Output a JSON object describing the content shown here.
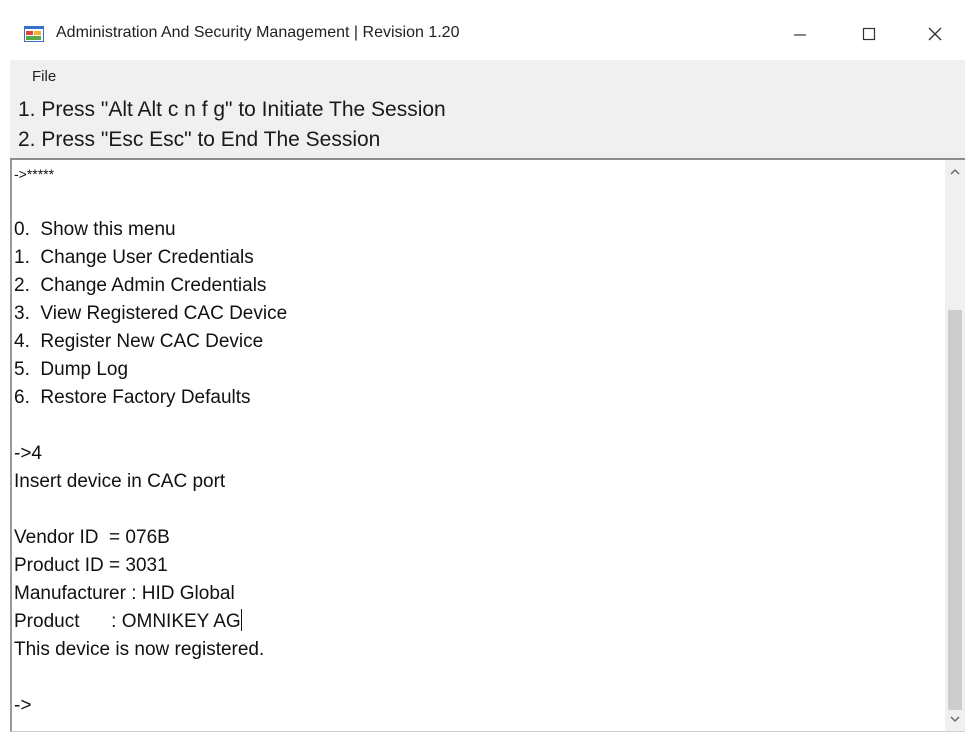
{
  "window": {
    "title": "Administration And Security Management  |  Revision 1.20",
    "icon": "app-window-icon",
    "controls": {
      "minimize_icon": "minimize-icon",
      "maximize_icon": "maximize-icon",
      "close_icon": "close-icon"
    }
  },
  "menubar": {
    "items": [
      {
        "label": "File"
      }
    ]
  },
  "instructions": [
    "1. Press \"Alt Alt c n f g\" to Initiate The Session",
    "2. Press \"Esc Esc\" to End The Session"
  ],
  "console": {
    "lines": [
      "->*****",
      "",
      "0.  Show this menu",
      "1.  Change User Credentials",
      "2.  Change Admin Credentials",
      "3.  View Registered CAC Device",
      "4.  Register New CAC Device",
      "5.  Dump Log",
      "6.  Restore Factory Defaults",
      "",
      "->4",
      "Insert device in CAC port",
      "",
      "Vendor ID  = 076B",
      "Product ID = 3031",
      "Manufacturer : HID Global",
      "Product      : OMNIKEY AG",
      "This device is now registered.",
      "",
      "->"
    ]
  },
  "colors": {
    "menu_bg": "#f0f0f0",
    "text": "#111111",
    "scroll_thumb": "#cdcdcd"
  }
}
